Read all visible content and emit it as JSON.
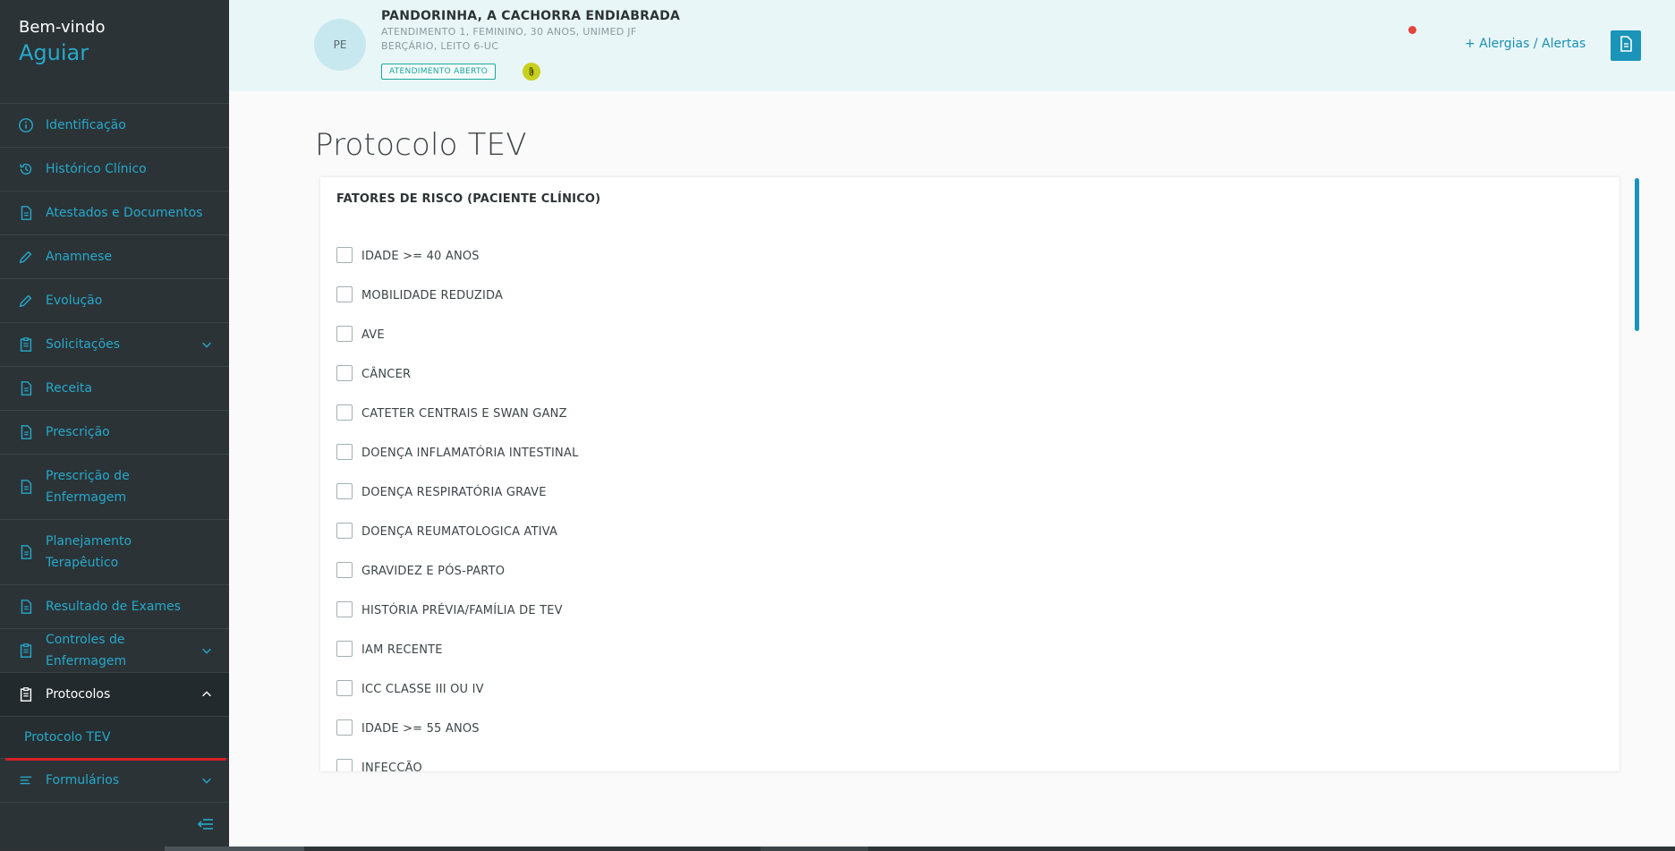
{
  "sidebar": {
    "welcome": "Bem-vindo",
    "user": "Aguiar",
    "items": [
      {
        "label": "Identificação",
        "icon": "info-icon"
      },
      {
        "label": "Histórico Clínico",
        "icon": "history-icon"
      },
      {
        "label": "Atestados e Documentos",
        "icon": "document-icon"
      },
      {
        "label": "Anamnese",
        "icon": "pencil-icon"
      },
      {
        "label": "Evolução",
        "icon": "pencil-icon"
      },
      {
        "label": "Solicitações",
        "icon": "clipboard-icon"
      },
      {
        "label": "Receita",
        "icon": "document-icon"
      },
      {
        "label": "Prescrição",
        "icon": "document-icon"
      },
      {
        "label": "Prescrição de Enfermagem",
        "icon": "document-icon"
      },
      {
        "label": "Planejamento Terapêutico",
        "icon": "document-icon"
      },
      {
        "label": "Resultado de Exames",
        "icon": "document-icon"
      },
      {
        "label": "Controles de Enfermagem",
        "icon": "clipboard-icon"
      },
      {
        "label": "Protocolos",
        "icon": "clipboard-icon"
      },
      {
        "label": "Formulários",
        "icon": "list-icon"
      }
    ],
    "sub_item": "Protocolo TEV"
  },
  "header": {
    "avatar_initials": "PE",
    "patient_name": "PANDORINHA, A CACHORRA ENDIABRADA",
    "details_line1": "ATENDIMENTO 1, FEMININO, 30 ANOS, UNIMED JF",
    "details_line2": "BERÇÁRIO, LEITO 6-UC",
    "status": "ATENDIMENTO ABERTO",
    "alerts_link": "+  Alergias / Alertas"
  },
  "main": {
    "title": "Protocolo TEV",
    "section_title": "FATORES DE RISCO (PACIENTE CLÍNICO)",
    "risk_factors": [
      "IDADE >= 40 ANOS",
      "MOBILIDADE REDUZIDA",
      "AVE",
      "CÂNCER",
      "CATETER CENTRAIS E SWAN GANZ",
      "DOENÇA INFLAMATÓRIA INTESTINAL",
      "DOENÇA RESPIRATÓRIA GRAVE",
      "DOENÇA REUMATOLOGICA ATIVA",
      "GRAVIDEZ E PÓS-PARTO",
      "HISTÓRIA PRÉVIA/FAMÍLIA DE TEV",
      "IAM RECENTE",
      "ICC CLASSE III OU IV",
      "IDADE >= 55 ANOS",
      "INFECÇÃO"
    ]
  },
  "colors": {
    "accent": "#27a9c9",
    "sidebar_bg": "#2b3337",
    "header_bg": "#e9f6f7",
    "status_green": "#1aa89c",
    "active_underline": "#d81f26"
  }
}
